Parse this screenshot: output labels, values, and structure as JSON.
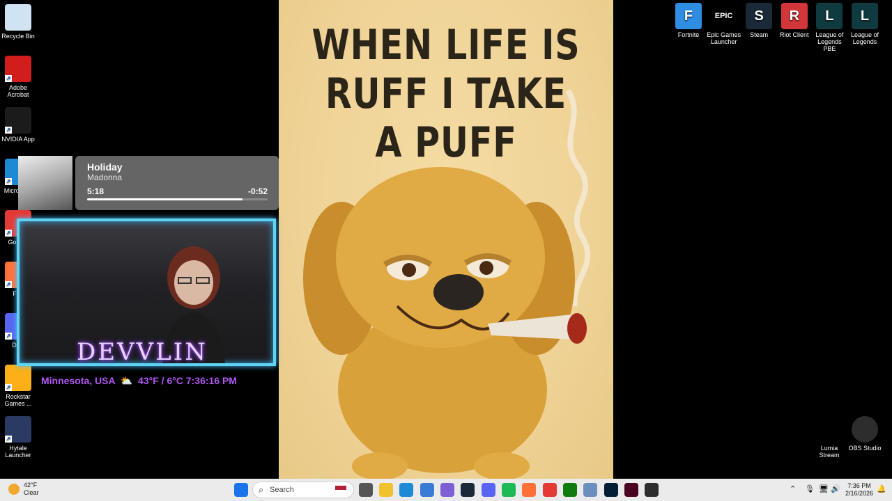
{
  "desktop_left": [
    {
      "label": "Recycle Bin",
      "icon": "recycle-bin-icon",
      "color": "#cfe3f2"
    },
    {
      "label": "Adobe Acrobat",
      "icon": "adobe-acrobat-icon",
      "color": "#d21d1d"
    },
    {
      "label": "NVIDIA App",
      "icon": "nvidia-icon",
      "color": "#1b1b1b"
    },
    {
      "label": "Micro Edg",
      "icon": "edge-icon",
      "color": "#1e8ad6"
    },
    {
      "label": "Go Chr",
      "icon": "chrome-icon",
      "color": "#e53935"
    },
    {
      "label": "Fire",
      "icon": "firefox-icon",
      "color": "#ff7139"
    },
    {
      "label": "Disc",
      "icon": "discord-icon",
      "color": "#5865f2"
    },
    {
      "label": "Rockstar Games ...",
      "icon": "rockstar-icon",
      "color": "#fcaf17"
    },
    {
      "label": "Hytale Launcher",
      "icon": "hytale-icon",
      "color": "#2a3a63"
    }
  ],
  "desktop_top_right": [
    {
      "label": "Fortnite",
      "icon": "fortnite-icon",
      "color": "#2f8de4",
      "glyph": "F"
    },
    {
      "label": "Epic Games Launcher",
      "icon": "epic-games-icon",
      "color": "#000000",
      "glyph": "EPIC"
    },
    {
      "label": "Steam",
      "icon": "steam-icon",
      "color": "#1b2838",
      "glyph": "S"
    },
    {
      "label": "Riot Client",
      "icon": "riot-client-icon",
      "color": "#d13639",
      "glyph": "R"
    },
    {
      "label": "League of Legends PBE",
      "icon": "league-pbe-icon",
      "color": "#0f3a3f",
      "glyph": "L"
    },
    {
      "label": "League of Legends",
      "icon": "league-icon",
      "color": "#0f3a3f",
      "glyph": "L"
    }
  ],
  "desktop_bottom_right": [
    {
      "label": "Lumia Stream",
      "icon": "lumia-stream-icon",
      "color": "#000000"
    },
    {
      "label": "OBS Studio",
      "icon": "obs-studio-icon",
      "color": "#2d2d2d"
    }
  ],
  "poster": {
    "title": "WHEN LIFE IS\nRUFF I TAKE\nA PUFF"
  },
  "music": {
    "song": "Holiday",
    "artist": "Madonna",
    "elapsed": "5:18",
    "remaining": "-0:52",
    "progress": 0.86
  },
  "stream_overlay": {
    "name": "DEVVLIN",
    "location": "Minnesota, USA",
    "weather_icon": "partly-cloudy-icon",
    "weather": "43°F / 6°C",
    "time": "7:36:16 PM"
  },
  "taskbar": {
    "weather_temp": "42°F",
    "weather_desc": "Clear",
    "search_placeholder": "Search",
    "clock_time": "7:36 PM",
    "clock_date": "2/16/2026",
    "pinned": [
      {
        "icon": "windows-start-icon",
        "color": "#1a73e8"
      },
      {
        "icon": "task-view-icon",
        "color": "#555555"
      },
      {
        "icon": "file-explorer-icon",
        "color": "#f2c12e"
      },
      {
        "icon": "edge-icon",
        "color": "#1e8ad6"
      },
      {
        "icon": "microsoft-store-icon",
        "color": "#3a7bd5"
      },
      {
        "icon": "copilot-icon",
        "color": "#7d5fd6"
      },
      {
        "icon": "steam-icon",
        "color": "#1b2838"
      },
      {
        "icon": "discord-icon",
        "color": "#5865f2"
      },
      {
        "icon": "spotify-icon",
        "color": "#1db954"
      },
      {
        "icon": "firefox-icon",
        "color": "#ff7139"
      },
      {
        "icon": "chrome-icon",
        "color": "#e53935"
      },
      {
        "icon": "xbox-icon",
        "color": "#107c10"
      },
      {
        "icon": "notepad-icon",
        "color": "#6c8ebf"
      },
      {
        "icon": "photoshop-icon",
        "color": "#001e36"
      },
      {
        "icon": "indesign-icon",
        "color": "#49021f"
      },
      {
        "icon": "obs-icon",
        "color": "#2d2d2d"
      }
    ]
  }
}
